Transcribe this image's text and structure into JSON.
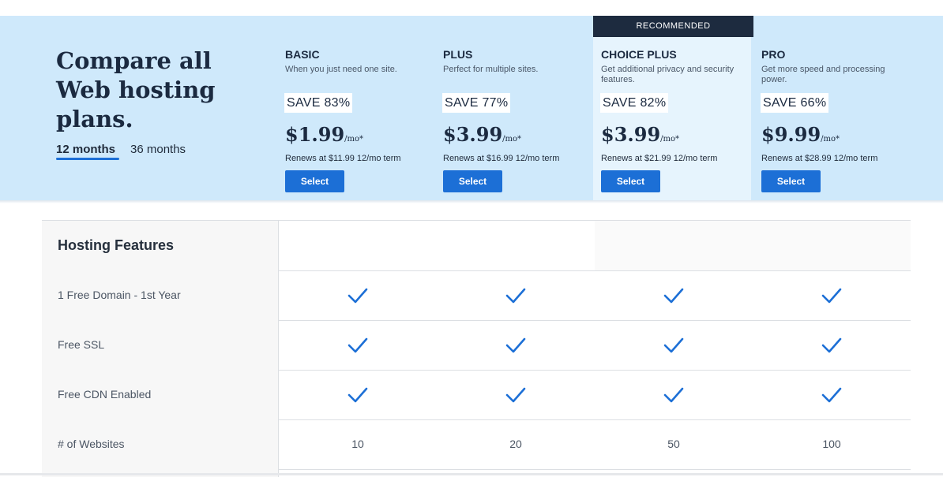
{
  "header": {
    "title": "Compare all Web hosting plans.",
    "term_tabs": [
      {
        "label": "12 months",
        "active": true
      },
      {
        "label": "36 months",
        "active": false
      }
    ],
    "recommended_label": "RECOMMENDED"
  },
  "plans": [
    {
      "name": "BASIC",
      "description": "When you just need one site.",
      "save": "SAVE 83%",
      "price": "$1.99",
      "price_suffix": "/mo*",
      "renews": "Renews at $11.99 12/mo term",
      "button": "Select"
    },
    {
      "name": "PLUS",
      "description": "Perfect for multiple sites.",
      "save": "SAVE 77%",
      "price": "$3.99",
      "price_suffix": "/mo*",
      "renews": "Renews at $16.99 12/mo term",
      "button": "Select"
    },
    {
      "name": "CHOICE PLUS",
      "description": "Get additional privacy and security features.",
      "save": "SAVE 82%",
      "price": "$3.99",
      "price_suffix": "/mo*",
      "renews": "Renews at $21.99 12/mo term",
      "button": "Select",
      "recommended": true
    },
    {
      "name": "PRO",
      "description": "Get more speed and processing power.",
      "save": "SAVE 66%",
      "price": "$9.99",
      "price_suffix": "/mo*",
      "renews": "Renews at $28.99 12/mo term",
      "button": "Select"
    }
  ],
  "features": {
    "section_title": "Hosting Features",
    "rows": [
      {
        "label": "1 Free Domain - 1st Year",
        "values": [
          "check",
          "check",
          "check",
          "check"
        ]
      },
      {
        "label": "Free SSL",
        "values": [
          "check",
          "check",
          "check",
          "check"
        ]
      },
      {
        "label": "Free CDN Enabled",
        "values": [
          "check",
          "check",
          "check",
          "check"
        ]
      },
      {
        "label": "# of Websites",
        "values": [
          "10",
          "20",
          "50",
          "100"
        ]
      }
    ]
  },
  "colors": {
    "band": "#cfe9fb",
    "recommended_bg": "#e6f4fd",
    "accent": "#1c6fd6",
    "dark": "#1d2b3f"
  },
  "icons": {
    "check": "checkmark-icon"
  }
}
